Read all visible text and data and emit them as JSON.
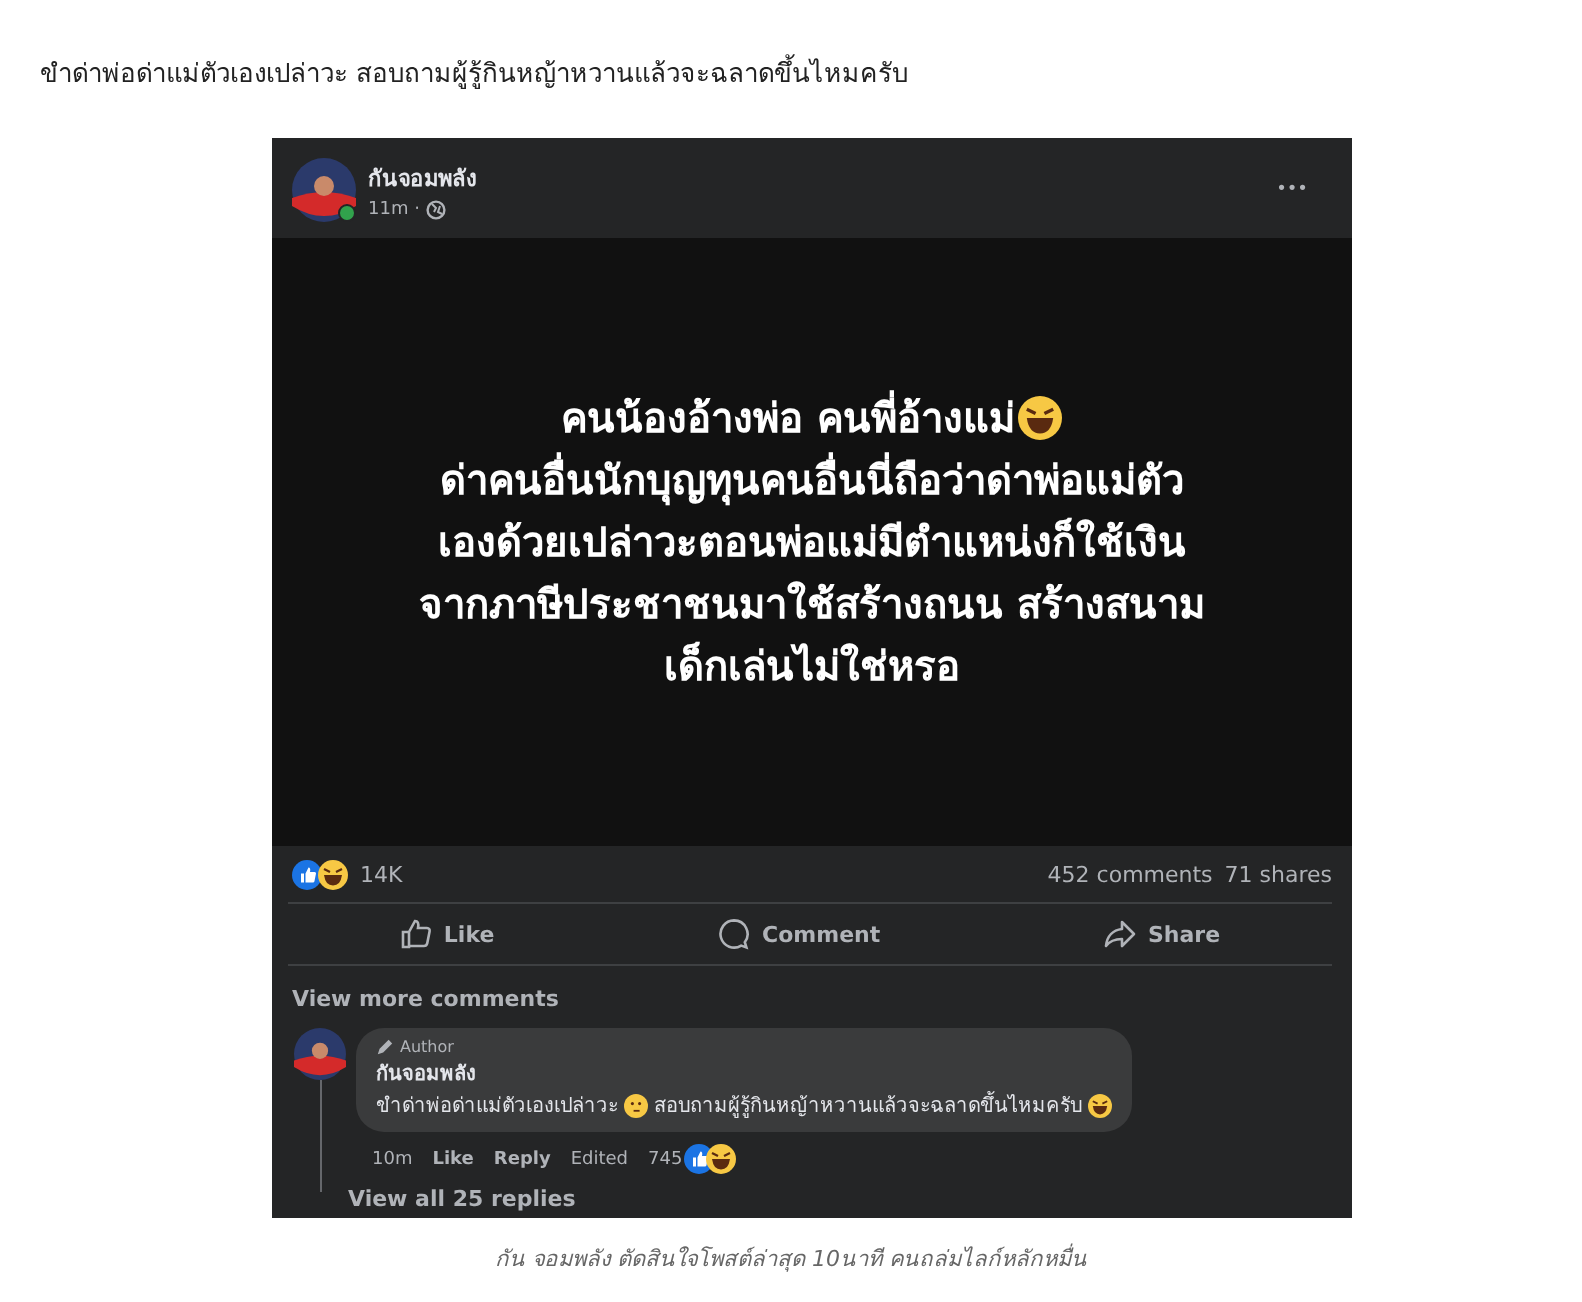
{
  "headline": "ขำด่าพ่อด่าแม่ตัวเองเปล่าวะ สอบถามผู้รู้กินหญ้าหวานแล้วจะฉลาดขึ้นไหมครับ",
  "post": {
    "author": "กันจอมพลัง",
    "online": true,
    "time": "11m ·",
    "menu": "•••",
    "lines": [
      {
        "text": "คนน้องอ้างพ่อ คนพี่อ้างแม่",
        "trailing_emoji": true
      },
      {
        "text": "ด่าคนอื่นนักบุญทุนคนอื่นนี่ถือว่าด่าพ่อแม่ตัว"
      },
      {
        "text": "เองด้วยเปล่าวะตอนพ่อแม่มีตำแหน่งก็ใช้เงิน"
      },
      {
        "text": "จากภาษีประชาชนมาใช้สร้างถนน สร้างสนาม"
      },
      {
        "text": "เด็กเล่นไม่ใช่หรอ"
      }
    ],
    "reactions": "14K",
    "comments": "452 comments",
    "shares": "71 shares",
    "actions": [
      {
        "kind": "like",
        "label": "Like"
      },
      {
        "kind": "comment",
        "label": "Comment"
      },
      {
        "kind": "share",
        "label": "Share"
      }
    ],
    "view_more": "View more comments",
    "comment": {
      "badge": "Author",
      "author": "กันจอมพลัง",
      "text_before": "ขำด่าพ่อด่าแม่ตัวเองเปล่าวะ",
      "text_after": "สอบถามผู้รู้กินหญ้าหวานแล้วจะฉลาดขึ้นไหมครับ",
      "time": "10m",
      "like": "Like",
      "reply": "Reply",
      "edited": "Edited",
      "reactions": "745"
    },
    "view_replies": "View all 25 replies"
  },
  "caption": "กัน จอมพลัง ตัดสินใจโพสต์ล่าสุด 10นาที คนถล่มไลก์หลักหมื่น"
}
